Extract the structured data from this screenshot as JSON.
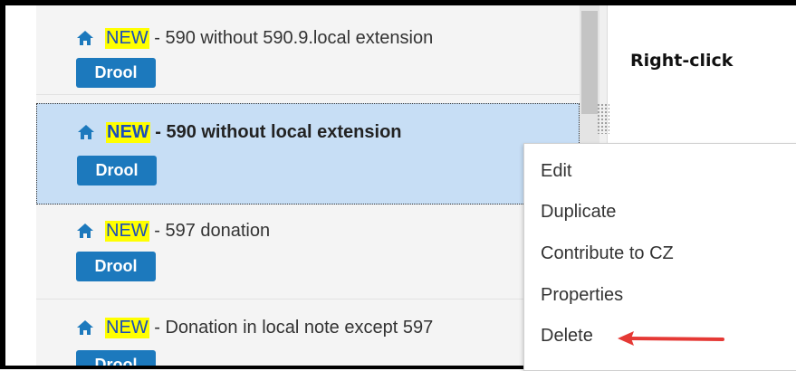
{
  "list": {
    "items": [
      {
        "new_tag": "NEW",
        "title": "590 without 590.9.local extension",
        "badge": "Drool"
      },
      {
        "new_tag": "NEW",
        "title": "590 without local extension",
        "badge": "Drool"
      },
      {
        "new_tag": "NEW",
        "title": "597 donation",
        "badge": "Drool"
      },
      {
        "new_tag": "NEW",
        "title": "Donation in local note except 597",
        "badge": "Drool"
      }
    ],
    "separator": " - "
  },
  "right_panel": {
    "heading": "Right-click"
  },
  "context_menu": {
    "items": [
      "Edit",
      "Duplicate",
      "Contribute to CZ",
      "Properties",
      "Delete"
    ]
  },
  "icons": {
    "item_icon": "home-icon",
    "annotation": "red-arrow-icon"
  },
  "colors": {
    "new_highlight": "#ffff00",
    "new_text": "#1a4dbb",
    "badge": "#1c79bd",
    "selected_row": "#c7def5",
    "home_icon": "#1c79bd",
    "arrow": "#e53935"
  }
}
